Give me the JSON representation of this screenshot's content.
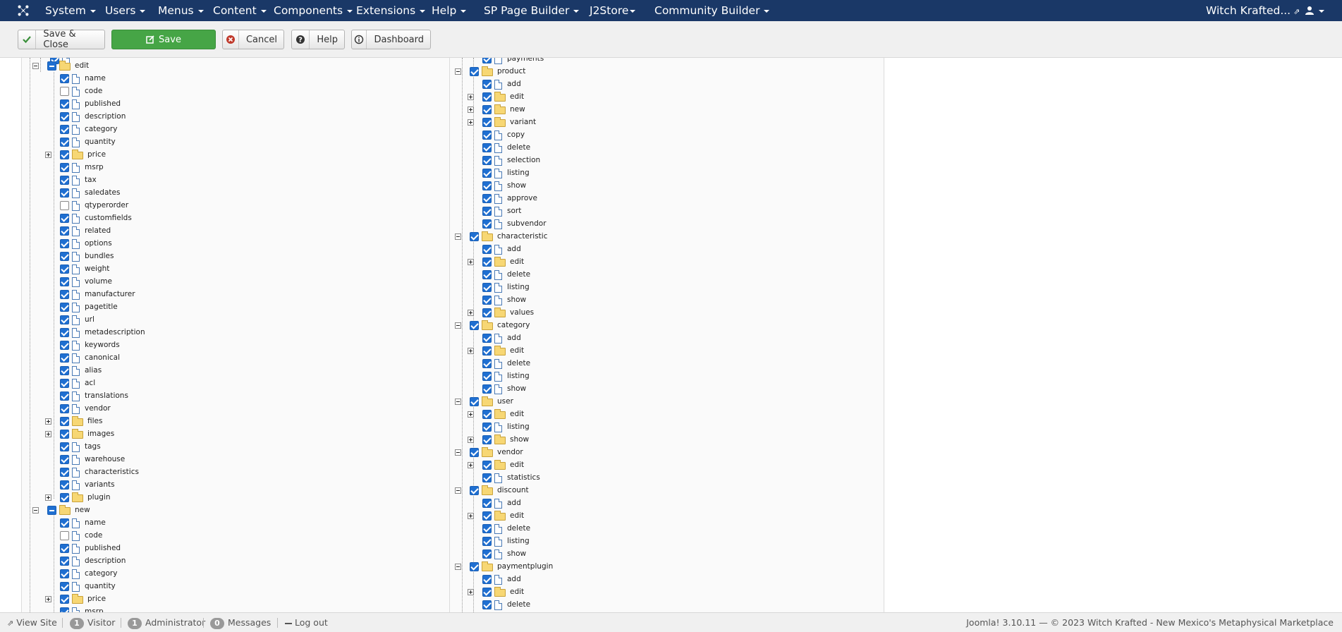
{
  "navbar": {
    "menus": [
      {
        "label": "System",
        "caret": true
      },
      {
        "label": "Users",
        "caret": true
      },
      {
        "label": "Menus",
        "caret": true
      },
      {
        "label": "Content",
        "caret": true
      },
      {
        "label": "Components",
        "caret": true
      },
      {
        "label": "Extensions",
        "caret": true
      },
      {
        "label": "Help",
        "caret": true
      },
      {
        "label": "SP Page Builder",
        "caret": true
      },
      {
        "label": "J2Store",
        "caret": true
      },
      {
        "label": "Community Builder",
        "caret": true
      }
    ],
    "site_link": "Witch Krafted...",
    "user_icon": "user-icon"
  },
  "toolbar": {
    "save_close_label": "Save & Close",
    "save_label": "Save",
    "cancel_label": "Cancel",
    "help_label": "Help",
    "dashboard_label": "Dashboard"
  },
  "tree_left": [
    {
      "label": "edit",
      "type": "folder",
      "depth": 1,
      "checked": "partial",
      "expander": "minus"
    },
    {
      "label": "name",
      "type": "file",
      "depth": 2,
      "checked": "on"
    },
    {
      "label": "code",
      "type": "file",
      "depth": 2,
      "checked": "off"
    },
    {
      "label": "published",
      "type": "file",
      "depth": 2,
      "checked": "on"
    },
    {
      "label": "description",
      "type": "file",
      "depth": 2,
      "checked": "on"
    },
    {
      "label": "category",
      "type": "file",
      "depth": 2,
      "checked": "on"
    },
    {
      "label": "quantity",
      "type": "file",
      "depth": 2,
      "checked": "on"
    },
    {
      "label": "price",
      "type": "folder",
      "depth": 2,
      "checked": "on",
      "expander": "plus"
    },
    {
      "label": "msrp",
      "type": "file",
      "depth": 2,
      "checked": "on"
    },
    {
      "label": "tax",
      "type": "file",
      "depth": 2,
      "checked": "on"
    },
    {
      "label": "saledates",
      "type": "file",
      "depth": 2,
      "checked": "on"
    },
    {
      "label": "qtyperorder",
      "type": "file",
      "depth": 2,
      "checked": "off"
    },
    {
      "label": "customfields",
      "type": "file",
      "depth": 2,
      "checked": "on"
    },
    {
      "label": "related",
      "type": "file",
      "depth": 2,
      "checked": "on"
    },
    {
      "label": "options",
      "type": "file",
      "depth": 2,
      "checked": "on"
    },
    {
      "label": "bundles",
      "type": "file",
      "depth": 2,
      "checked": "on"
    },
    {
      "label": "weight",
      "type": "file",
      "depth": 2,
      "checked": "on"
    },
    {
      "label": "volume",
      "type": "file",
      "depth": 2,
      "checked": "on"
    },
    {
      "label": "manufacturer",
      "type": "file",
      "depth": 2,
      "checked": "on"
    },
    {
      "label": "pagetitle",
      "type": "file",
      "depth": 2,
      "checked": "on"
    },
    {
      "label": "url",
      "type": "file",
      "depth": 2,
      "checked": "on"
    },
    {
      "label": "metadescription",
      "type": "file",
      "depth": 2,
      "checked": "on"
    },
    {
      "label": "keywords",
      "type": "file",
      "depth": 2,
      "checked": "on"
    },
    {
      "label": "canonical",
      "type": "file",
      "depth": 2,
      "checked": "on"
    },
    {
      "label": "alias",
      "type": "file",
      "depth": 2,
      "checked": "on"
    },
    {
      "label": "acl",
      "type": "file",
      "depth": 2,
      "checked": "on"
    },
    {
      "label": "translations",
      "type": "file",
      "depth": 2,
      "checked": "on"
    },
    {
      "label": "vendor",
      "type": "file",
      "depth": 2,
      "checked": "on"
    },
    {
      "label": "files",
      "type": "folder",
      "depth": 2,
      "checked": "on",
      "expander": "plus"
    },
    {
      "label": "images",
      "type": "folder",
      "depth": 2,
      "checked": "on",
      "expander": "plus"
    },
    {
      "label": "tags",
      "type": "file",
      "depth": 2,
      "checked": "on"
    },
    {
      "label": "warehouse",
      "type": "file",
      "depth": 2,
      "checked": "on"
    },
    {
      "label": "characteristics",
      "type": "file",
      "depth": 2,
      "checked": "on"
    },
    {
      "label": "variants",
      "type": "file",
      "depth": 2,
      "checked": "on"
    },
    {
      "label": "plugin",
      "type": "folder",
      "depth": 2,
      "checked": "on",
      "expander": "plus"
    },
    {
      "label": "new",
      "type": "folder",
      "depth": 1,
      "checked": "partial",
      "expander": "minus"
    },
    {
      "label": "name",
      "type": "file",
      "depth": 2,
      "checked": "on"
    },
    {
      "label": "code",
      "type": "file",
      "depth": 2,
      "checked": "off"
    },
    {
      "label": "published",
      "type": "file",
      "depth": 2,
      "checked": "on"
    },
    {
      "label": "description",
      "type": "file",
      "depth": 2,
      "checked": "on"
    },
    {
      "label": "category",
      "type": "file",
      "depth": 2,
      "checked": "on"
    },
    {
      "label": "quantity",
      "type": "file",
      "depth": 2,
      "checked": "on"
    },
    {
      "label": "price",
      "type": "folder",
      "depth": 2,
      "checked": "on",
      "expander": "plus"
    },
    {
      "label": "msrp",
      "type": "file",
      "depth": 2,
      "checked": "on"
    }
  ],
  "tree_right": [
    {
      "label": "payments",
      "type": "file",
      "depth": 2,
      "checked": "on"
    },
    {
      "label": "product",
      "type": "folder",
      "depth": 1,
      "checked": "on",
      "expander": "minus"
    },
    {
      "label": "add",
      "type": "file",
      "depth": 2,
      "checked": "on"
    },
    {
      "label": "edit",
      "type": "folder",
      "depth": 2,
      "checked": "on",
      "expander": "plus"
    },
    {
      "label": "new",
      "type": "folder",
      "depth": 2,
      "checked": "on",
      "expander": "plus"
    },
    {
      "label": "variant",
      "type": "folder",
      "depth": 2,
      "checked": "on",
      "expander": "plus"
    },
    {
      "label": "copy",
      "type": "file",
      "depth": 2,
      "checked": "on"
    },
    {
      "label": "delete",
      "type": "file",
      "depth": 2,
      "checked": "on"
    },
    {
      "label": "selection",
      "type": "file",
      "depth": 2,
      "checked": "on"
    },
    {
      "label": "listing",
      "type": "file",
      "depth": 2,
      "checked": "on"
    },
    {
      "label": "show",
      "type": "file",
      "depth": 2,
      "checked": "on"
    },
    {
      "label": "approve",
      "type": "file",
      "depth": 2,
      "checked": "on"
    },
    {
      "label": "sort",
      "type": "file",
      "depth": 2,
      "checked": "on"
    },
    {
      "label": "subvendor",
      "type": "file",
      "depth": 2,
      "checked": "on"
    },
    {
      "label": "characteristic",
      "type": "folder",
      "depth": 1,
      "checked": "on",
      "expander": "minus"
    },
    {
      "label": "add",
      "type": "file",
      "depth": 2,
      "checked": "on"
    },
    {
      "label": "edit",
      "type": "folder",
      "depth": 2,
      "checked": "on",
      "expander": "plus"
    },
    {
      "label": "delete",
      "type": "file",
      "depth": 2,
      "checked": "on"
    },
    {
      "label": "listing",
      "type": "file",
      "depth": 2,
      "checked": "on"
    },
    {
      "label": "show",
      "type": "file",
      "depth": 2,
      "checked": "on"
    },
    {
      "label": "values",
      "type": "folder",
      "depth": 2,
      "checked": "on",
      "expander": "plus"
    },
    {
      "label": "category",
      "type": "folder",
      "depth": 1,
      "checked": "on",
      "expander": "minus"
    },
    {
      "label": "add",
      "type": "file",
      "depth": 2,
      "checked": "on"
    },
    {
      "label": "edit",
      "type": "folder",
      "depth": 2,
      "checked": "on",
      "expander": "plus"
    },
    {
      "label": "delete",
      "type": "file",
      "depth": 2,
      "checked": "on"
    },
    {
      "label": "listing",
      "type": "file",
      "depth": 2,
      "checked": "on"
    },
    {
      "label": "show",
      "type": "file",
      "depth": 2,
      "checked": "on"
    },
    {
      "label": "user",
      "type": "folder",
      "depth": 1,
      "checked": "on",
      "expander": "minus"
    },
    {
      "label": "edit",
      "type": "folder",
      "depth": 2,
      "checked": "on",
      "expander": "plus"
    },
    {
      "label": "listing",
      "type": "file",
      "depth": 2,
      "checked": "on"
    },
    {
      "label": "show",
      "type": "folder",
      "depth": 2,
      "checked": "on",
      "expander": "plus"
    },
    {
      "label": "vendor",
      "type": "folder",
      "depth": 1,
      "checked": "on",
      "expander": "minus"
    },
    {
      "label": "edit",
      "type": "folder",
      "depth": 2,
      "checked": "on",
      "expander": "plus"
    },
    {
      "label": "statistics",
      "type": "file",
      "depth": 2,
      "checked": "on"
    },
    {
      "label": "discount",
      "type": "folder",
      "depth": 1,
      "checked": "on",
      "expander": "minus"
    },
    {
      "label": "add",
      "type": "file",
      "depth": 2,
      "checked": "on"
    },
    {
      "label": "edit",
      "type": "folder",
      "depth": 2,
      "checked": "on",
      "expander": "plus"
    },
    {
      "label": "delete",
      "type": "file",
      "depth": 2,
      "checked": "on"
    },
    {
      "label": "listing",
      "type": "file",
      "depth": 2,
      "checked": "on"
    },
    {
      "label": "show",
      "type": "file",
      "depth": 2,
      "checked": "on"
    },
    {
      "label": "paymentplugin",
      "type": "folder",
      "depth": 1,
      "checked": "on",
      "expander": "minus"
    },
    {
      "label": "add",
      "type": "file",
      "depth": 2,
      "checked": "on"
    },
    {
      "label": "edit",
      "type": "folder",
      "depth": 2,
      "checked": "on",
      "expander": "plus"
    },
    {
      "label": "delete",
      "type": "file",
      "depth": 2,
      "checked": "on"
    }
  ],
  "statusbar": {
    "view_site": "View Site",
    "visitor_count": "1",
    "visitor_label": "Visitor",
    "admin_count": "1",
    "admin_label": "Administrator",
    "messages_count": "0",
    "messages_label": "Messages",
    "logout_label": "Log out",
    "footer_text": "Joomla! 3.10.11 — © 2023 Witch Krafted - New Mexico's Metaphysical Marketplace"
  }
}
